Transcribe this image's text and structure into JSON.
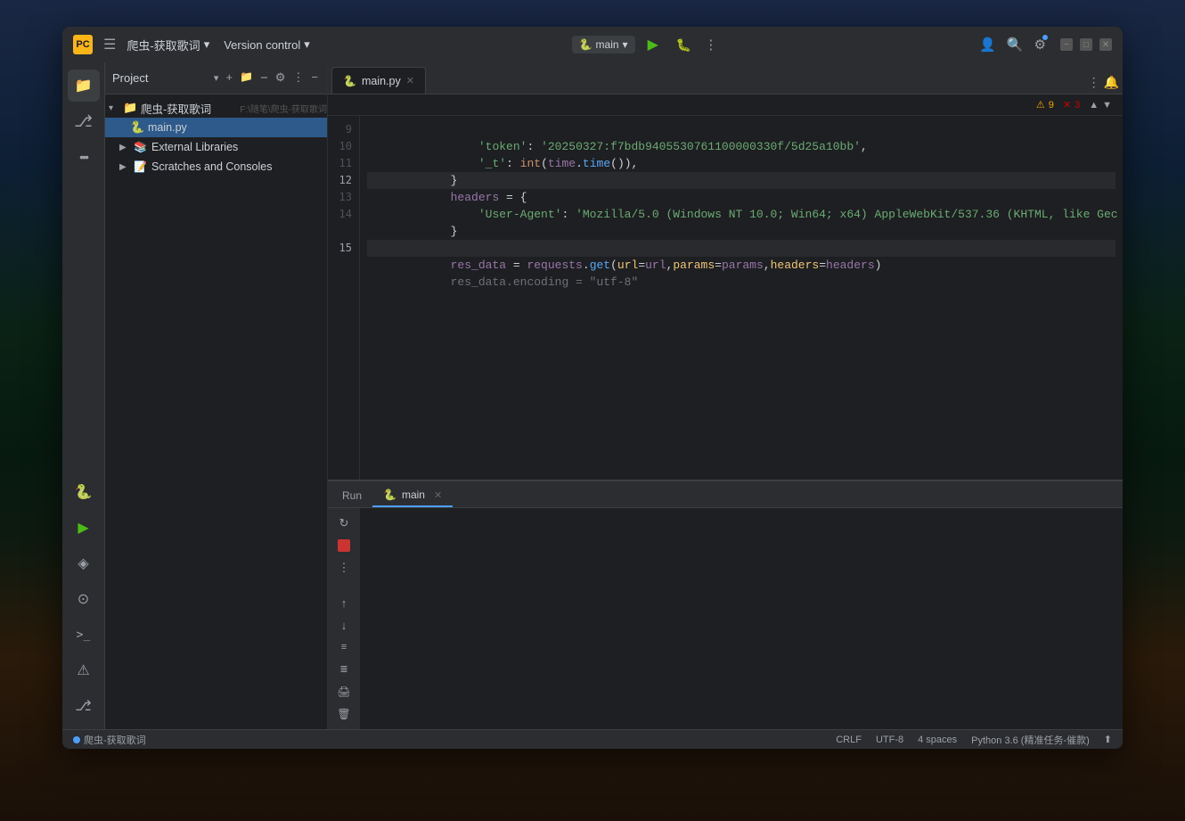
{
  "window": {
    "title": "爬虫-获取歌词",
    "logo_text": "PC",
    "branch": "main",
    "version_control": "Version control"
  },
  "titlebar": {
    "project_label": "爬虫-获取歌词",
    "chevron": "▾",
    "separator": "|",
    "vc_label": "Version control",
    "vc_chevron": "▾",
    "run_icon": "▶",
    "debug_icon": "🐛",
    "more_icon": "⋮",
    "profile_icon": "👤",
    "search_icon": "🔍",
    "settings_icon": "⚙",
    "minimize": "−",
    "maximize": "□",
    "close": "✕"
  },
  "sidebar": {
    "icons": [
      {
        "name": "folder-icon",
        "symbol": "📁",
        "active": true
      },
      {
        "name": "git-icon",
        "symbol": "⎇",
        "active": false
      },
      {
        "name": "more-icon",
        "symbol": "···",
        "active": false
      }
    ],
    "bottom_icons": [
      {
        "name": "python-packages-icon",
        "symbol": "🐍"
      },
      {
        "name": "run-icon",
        "symbol": "▶"
      },
      {
        "name": "layers-icon",
        "symbol": "◈"
      },
      {
        "name": "services-icon",
        "symbol": "⊙"
      },
      {
        "name": "terminal-icon",
        "symbol": ">_"
      },
      {
        "name": "problems-icon",
        "symbol": "⚠"
      },
      {
        "name": "git-branch-icon",
        "symbol": "⎇"
      }
    ]
  },
  "project_panel": {
    "title": "Project",
    "chevron": "▾",
    "actions": {
      "new_file": "+",
      "new_folder": "📁",
      "collapse": "−",
      "settings": "⚙",
      "close": "✕",
      "more": "⋮",
      "minimize": "−"
    },
    "tree": {
      "root": {
        "label": "爬虫-获取歌词",
        "path": "F:\\随笔\\爬虫-获取歌词",
        "expanded": true,
        "children": [
          {
            "label": "main.py",
            "icon": "🐍",
            "type": "file",
            "selected": true
          },
          {
            "label": "External Libraries",
            "icon": "📚",
            "type": "folder",
            "expanded": false,
            "children": []
          },
          {
            "label": "Scratches and Consoles",
            "icon": "📝",
            "type": "folder",
            "expanded": false,
            "children": []
          }
        ]
      }
    }
  },
  "editor": {
    "tabs": [
      {
        "label": "main.py",
        "icon": "🐍",
        "active": true,
        "closeable": true
      }
    ],
    "warnings": 9,
    "errors": 3,
    "lines": [
      {
        "num": 9,
        "content": "    'token': '20250327:f7bdb9405530761100000330f/5d25a10bb',",
        "type": "string"
      },
      {
        "num": 10,
        "content": "    '_t': int(time.time()),",
        "type": "code"
      },
      {
        "num": 11,
        "content": "}",
        "type": "code"
      },
      {
        "num": 12,
        "content": "headers = {",
        "type": "code"
      },
      {
        "num": 13,
        "content": "    'User-Agent': 'Mozilla/5.0 (Windows NT 10.0; Win64; x64) AppleWebKit/537.36 (KHTML, like Gec",
        "type": "code"
      },
      {
        "num": 14,
        "content": "}",
        "type": "code"
      },
      {
        "num": "",
        "content": "",
        "type": "blank"
      },
      {
        "num": 15,
        "content": "res_data = requests.get(url=url,params=params,headers=headers)",
        "type": "code"
      }
    ]
  },
  "run_panel": {
    "tabs": [
      {
        "label": "Run",
        "active": false
      },
      {
        "label": "main",
        "icon": "🐍",
        "active": true,
        "closeable": true
      }
    ],
    "toolbar": {
      "restart": "↻",
      "stop": "■",
      "more": "⋮"
    }
  },
  "status_bar": {
    "branch": "爬虫-获取歌词",
    "encoding": "CRLF",
    "charset": "UTF-8",
    "indent": "4 spaces",
    "interpreter": "Python 3.6 (精准任务-催款)",
    "share_icon": "⬆"
  }
}
